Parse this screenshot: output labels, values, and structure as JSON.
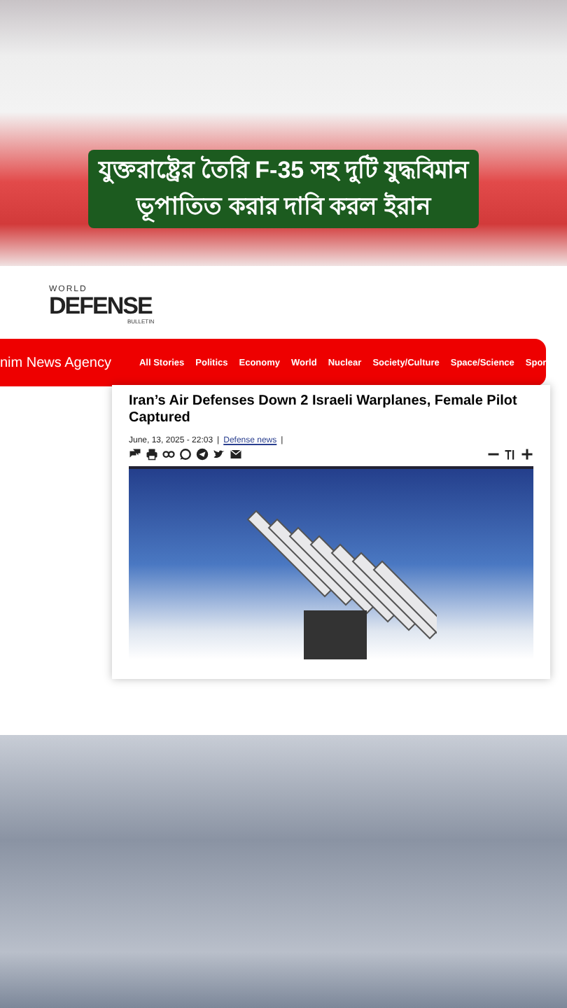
{
  "caption": {
    "lines": [
      "যুক্তরাষ্ট্রের তৈরি F-35 সহ দুটি যুদ্ধবিমান",
      "ভূপাতিত করার দাবি করল ইরান"
    ]
  },
  "site": {
    "logo_top": "WORLD",
    "logo_main": "DEFENSE",
    "logo_bottom": "BULLETIN"
  },
  "nav": {
    "agency": "nim News Agency",
    "items": [
      "All Stories",
      "Politics",
      "Economy",
      "World",
      "Nuclear",
      "Society/Culture",
      "Space/Science",
      "Spor"
    ]
  },
  "article": {
    "title": "Iran’s Air Defenses Down 2 Israeli Warplanes, Female Pilot Captured",
    "date": "June, 13, 2025 - 22:03",
    "category": "Defense news",
    "separators": [
      "|",
      "|"
    ]
  }
}
